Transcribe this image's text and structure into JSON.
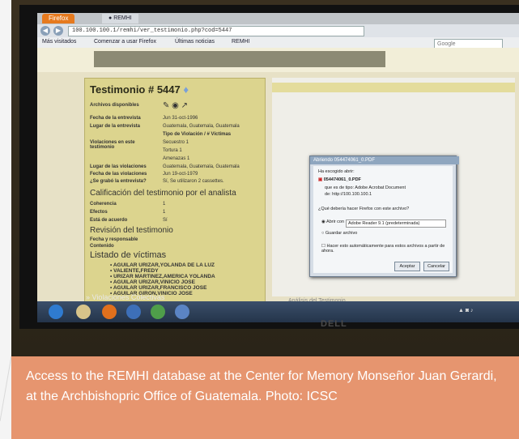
{
  "browser": {
    "tab_label": "Firefox",
    "tab_site": "REMHI",
    "url": "100.100.100.1/remhi/ver_testimonio.php?cod=5447",
    "bookmarks": [
      "Más visitados",
      "Comenzar a usar Firefox",
      "Últimas noticias",
      "REMHI"
    ],
    "search_placeholder": "Google"
  },
  "testimony": {
    "title": "Testimonio # 5447",
    "fields": [
      {
        "label": "Archivos disponibles",
        "value": ""
      },
      {
        "label": "Fecha de la entrevista",
        "value": "Jun 31-oct-1996"
      },
      {
        "label": "Lugar de la entrevista",
        "value": "Guatemala, Guatemala, Guatemala"
      },
      {
        "label": "Violaciones en este testimonio",
        "value": "Tipo de Violación / # Víctimas"
      },
      {
        "label": "",
        "value": "Secuestro 1"
      },
      {
        "label": "",
        "value": "Tortura 1"
      },
      {
        "label": "",
        "value": "Amenazas 1"
      },
      {
        "label": "Lugar de las violaciones",
        "value": "Guatemala, Guatemala, Guatemala"
      },
      {
        "label": "Fecha de las violaciones",
        "value": "Jun 19-oct-1979"
      },
      {
        "label": "¿Se grabó la entrevista?",
        "value": "Sí, Se utilizaron 2 cassettes."
      }
    ],
    "rating_heading": "Calificación del testimonio por el analista",
    "ratings": [
      {
        "label": "Coherencia",
        "value": "1"
      },
      {
        "label": "Efectos",
        "value": "1"
      },
      {
        "label": "Está de acuerdo",
        "value": "Sí"
      }
    ],
    "review_heading": "Revisión del testimonio",
    "review_fields": [
      "Fecha y responsable",
      "Contenido"
    ],
    "victims_heading": "Listado de víctimas",
    "victims": [
      "AGUILAR URIZAR,YOLANDA DE LA LUZ",
      "VALIENTE,FREDY",
      "URIZAR MARTINEZ,AMERICA YOLANDA",
      "AGUILAR URIZAR,VINICIO JOSE",
      "AGUILAR URIZAR,FRANCISCO JOSE",
      "AGUILAR GIRON,VINICIO JOSE"
    ]
  },
  "dialog": {
    "title": "Abriendo 054474061_0.PDF",
    "line1": "Ha escogido abrir:",
    "filename": "054474061_0.PDF",
    "type": "que es de tipo: Adobe Acrobat Document",
    "from": "de: http://100.100.100.1",
    "question": "¿Qué debería hacer Firefox con este archivo?",
    "open_with_label": "Abrir con",
    "open_with_value": "Adobe Reader 9.1 (predeterminada)",
    "save_label": "Guardar archivo",
    "auto_label": "Hacer esto automáticamente para estos archivos a partir de ahora.",
    "accept_label": "Aceptar",
    "cancel_label": "Cancelar"
  },
  "page_footer": {
    "analysis_label": "Análisis del Testimonio",
    "collective_label": "Violaciones Colectivas"
  },
  "monitor_brand": "DELL",
  "caption": "Access to the REMHI database at the Center for Memory Monseñor Juan Gerardi, at the Archbishopric Office of Guatemala. Photo: ICSC",
  "colors": {
    "caption_bg": "#e6956f",
    "panel_bg": "#dcd48e",
    "firefox_tab": "#e67a1e"
  }
}
